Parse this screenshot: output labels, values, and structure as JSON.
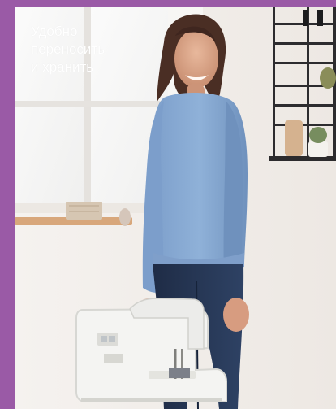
{
  "caption": {
    "lines": [
      "Удобно",
      "переносить",
      "и хранить"
    ]
  },
  "colors": {
    "frame": "#9a5aa6",
    "wall": "#f2eeea",
    "shirt": "#86a8d0",
    "jeans": "#24334f",
    "machine": "#f3f3f1",
    "shelf": "#2c2b2d"
  },
  "image": {
    "subject": "woman-holding-sewing-machine"
  }
}
